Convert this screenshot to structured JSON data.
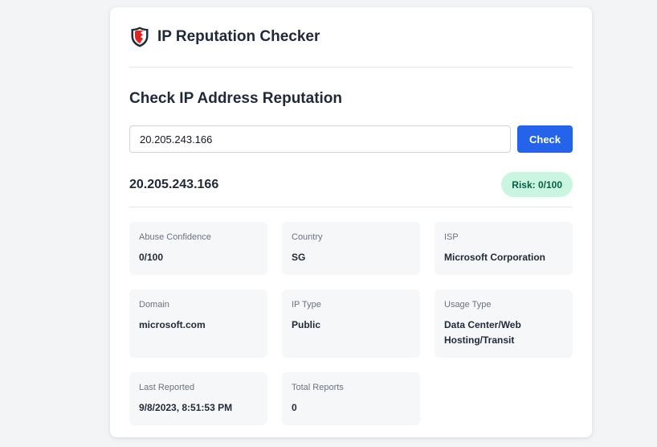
{
  "app": {
    "title": "IP Reputation Checker",
    "logo_icon": "shield-icon"
  },
  "section_title": "Check IP Address Reputation",
  "search": {
    "value": "20.205.243.166",
    "button_label": "Check"
  },
  "result": {
    "ip": "20.205.243.166",
    "risk_label": "Risk: 0/100",
    "risk_score": 0,
    "risk_max": 100,
    "fields": [
      {
        "label": "Abuse Confidence",
        "value": "0/100"
      },
      {
        "label": "Country",
        "value": "SG"
      },
      {
        "label": "ISP",
        "value": "Microsoft Corporation"
      },
      {
        "label": "Domain",
        "value": "microsoft.com"
      },
      {
        "label": "IP Type",
        "value": "Public"
      },
      {
        "label": "Usage Type",
        "value": "Data Center/Web Hosting/Transit"
      },
      {
        "label": "Last Reported",
        "value": "9/8/2023, 8:51:53 PM"
      },
      {
        "label": "Total Reports",
        "value": "0"
      }
    ]
  },
  "colors": {
    "accent": "#2563eb",
    "risk_badge_bg": "#c9f5e1",
    "risk_badge_text": "#065f46",
    "shield_red": "#dc2626"
  }
}
